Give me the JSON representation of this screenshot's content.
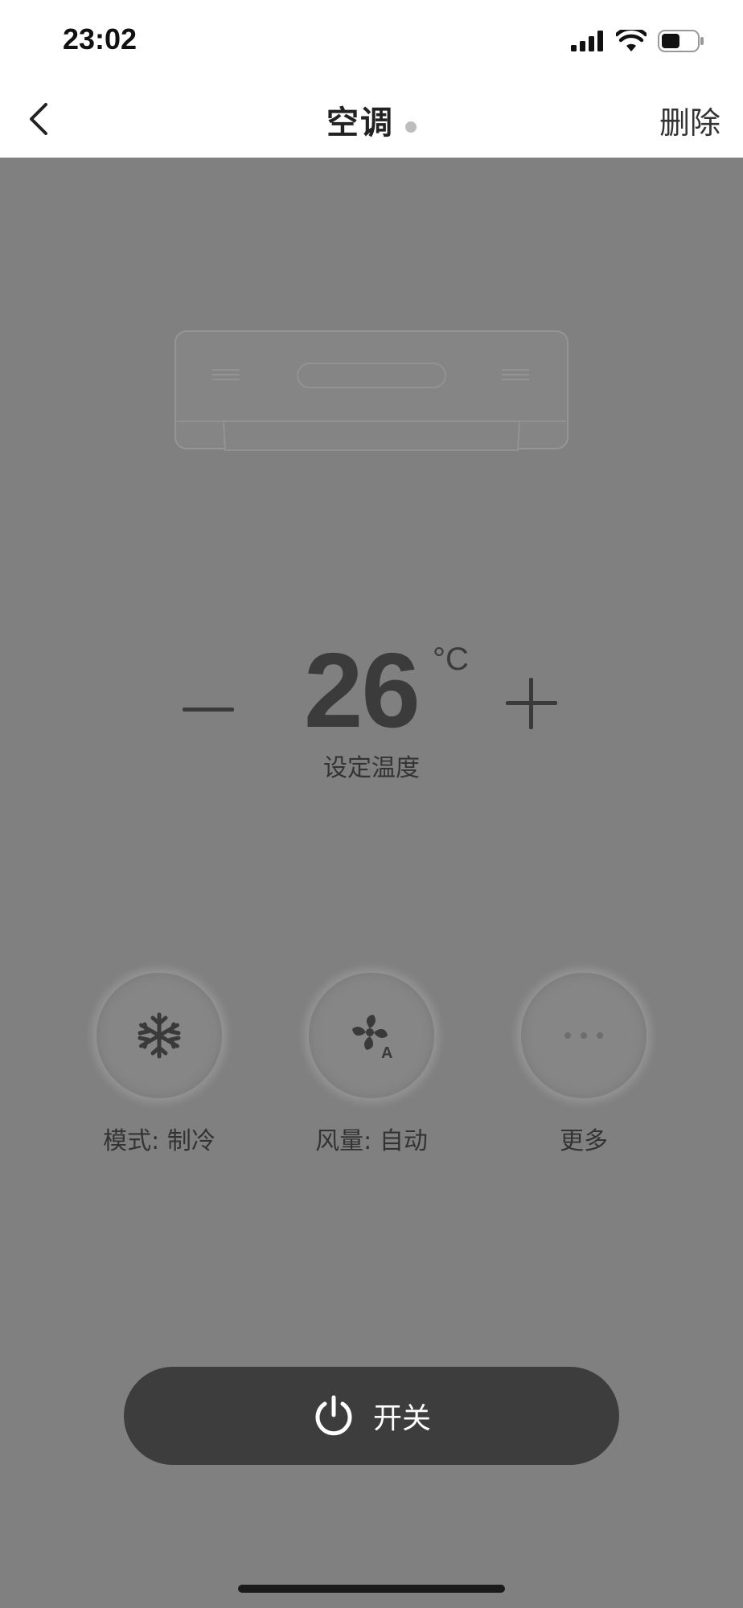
{
  "status_bar": {
    "time": "23:02"
  },
  "nav": {
    "title": "空调",
    "delete_label": "删除"
  },
  "temperature": {
    "value": "26",
    "unit": "°C",
    "label": "设定温度"
  },
  "controls": [
    {
      "label": "模式: 制冷",
      "icon": "snowflake-icon"
    },
    {
      "label": "风量: 自动",
      "icon": "fan-auto-icon"
    },
    {
      "label": "更多",
      "icon": "more-icon"
    }
  ],
  "power": {
    "label": "开关",
    "icon": "power-icon"
  },
  "colors": {
    "background": "#808080",
    "header": "#ffffff",
    "power_button": "#3d3d3d",
    "text_dark": "#333333"
  }
}
